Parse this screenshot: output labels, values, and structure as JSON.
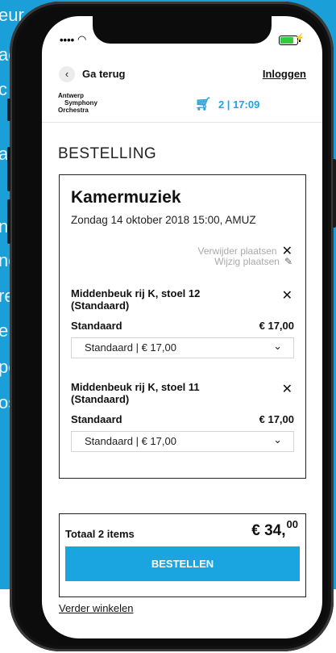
{
  "background_text": [
    "eur",
    "ac",
    "c",
    "al",
    "ng",
    "nc",
    "re",
    "e",
    "pe",
    "os"
  ],
  "status": {
    "signal": "••••",
    "wifi": "◠"
  },
  "nav": {
    "back_label": "Ga terug",
    "login_label": "Inloggen"
  },
  "logo": {
    "lines": [
      "Antwerp",
      "Symphony",
      "Orchestra"
    ]
  },
  "cart": {
    "count": "2",
    "time": "17:09",
    "separator": "|"
  },
  "heading": "BESTELLING",
  "order": {
    "event_title": "Kamermuziek",
    "event_date": "Zondag 14 oktober 2018 15:00, AMUZ",
    "remove_seats": "Verwijder plaatsen",
    "change_seats": "Wijzig plaatsen",
    "tickets": [
      {
        "seat": "Middenbeuk rij K, stoel 12 (Standaard)",
        "type": "Standaard",
        "price": "€ 17,00",
        "select_value": "Standaard | € 17,00"
      },
      {
        "seat": "Middenbeuk rij K, stoel 11 (Standaard)",
        "type": "Standaard",
        "price": "€ 17,00",
        "select_value": "Standaard | € 17,00"
      }
    ]
  },
  "total": {
    "label": "Totaal 2 items",
    "amount_main": "€ 34,",
    "amount_cents": "00",
    "order_button": "BESTELLEN"
  },
  "continue_shopping": "Verder winkelen",
  "colors": {
    "accent": "#1aa5e1",
    "page_bg": "#1a9fd8",
    "battery": "#2ecc40"
  }
}
